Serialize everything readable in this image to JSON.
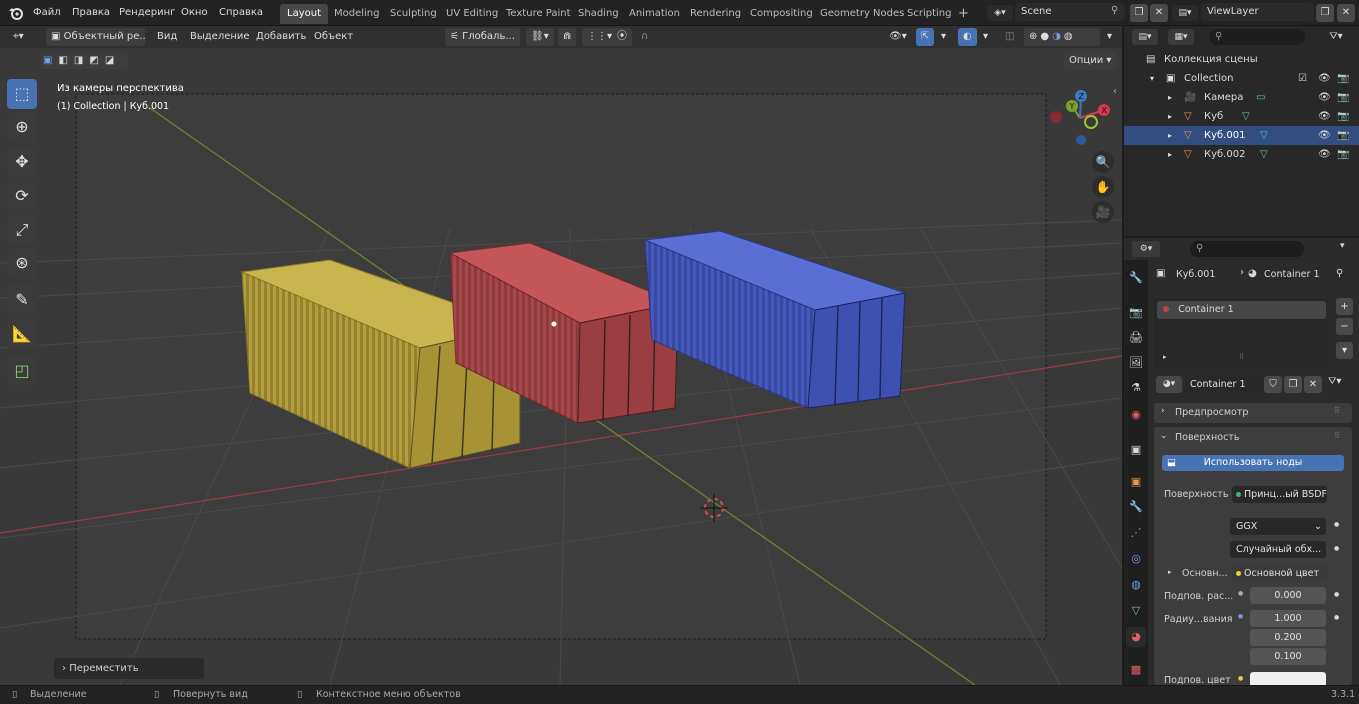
{
  "menu": [
    "Файл",
    "Правка",
    "Рендеринг",
    "Окно",
    "Справка"
  ],
  "workspaces": [
    "Layout",
    "Modeling",
    "Sculpting",
    "UV Editing",
    "Texture Paint",
    "Shading",
    "Animation",
    "Rendering",
    "Compositing",
    "Geometry Nodes",
    "Scripting"
  ],
  "add_workspace": "+",
  "scene": "Scene",
  "view_layer": "ViewLayer",
  "header": {
    "mode": "Объектный ре...",
    "view": "Вид",
    "select": "Выделение",
    "add": "Добавить",
    "object": "Объект",
    "orientation": "Глобаль...",
    "options": "Опции"
  },
  "viewport": {
    "view_name": "Из камеры перспектива",
    "collection_info": "(1) Collection | Куб.001",
    "last_op": "Переместить"
  },
  "gizmo": {
    "x": "X",
    "y": "Y",
    "z": "Z"
  },
  "outliner": {
    "scene_collection": "Коллекция сцены",
    "collection": "Collection",
    "items": [
      {
        "name": "Камера",
        "selected": false
      },
      {
        "name": "Куб",
        "selected": false
      },
      {
        "name": "Куб.001",
        "selected": true
      },
      {
        "name": "Куб.002",
        "selected": false
      }
    ]
  },
  "properties": {
    "object": "Куб.001",
    "material": "Container 1",
    "slot": "Container 1",
    "slots_more": "⠿",
    "mat_name": "Container 1",
    "preview": "Предпросмотр",
    "surface_section": "Поверхность",
    "use_nodes": "Использовать ноды",
    "surface_label": "Поверхность",
    "shader": "Принц...ый BSDF",
    "distribution": "GGX",
    "subsurface_method": "Случайный обх...",
    "base_label": "Основн...",
    "base_value": "Основной цвет",
    "sub_label": "Подпов. рас...",
    "sub_value": "0.000",
    "radius_label": "Радиу...вания",
    "radius": [
      "1.000",
      "0.200",
      "0.100"
    ],
    "sub_color_label": "Подпов. цвет"
  },
  "status": {
    "select": "Выделение",
    "rotate": "Повернуть вид",
    "context": "Контекстное меню объектов",
    "version": "3.3.1"
  },
  "colors": {
    "accent": "#4772b3",
    "selected_row": "#334d80",
    "x_axis": "#d8394b",
    "y_axis": "#7ba12d",
    "z_axis": "#3f78c9"
  }
}
